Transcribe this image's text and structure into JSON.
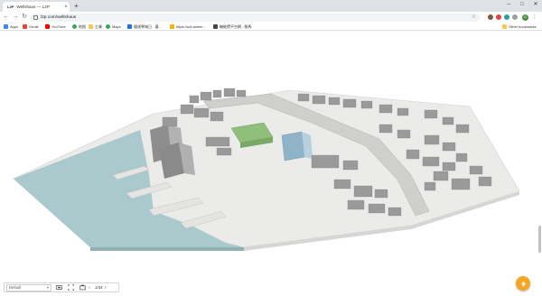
{
  "browser": {
    "tab": {
      "favicon_text": "L2P",
      "title": "Wellshaus — L2P"
    },
    "url": "l2p.com/wellshaus",
    "window_controls": {
      "minimize": "–",
      "maximize": "□",
      "close": "✕"
    },
    "avatar_letter": "G"
  },
  "bookmarks": [
    {
      "label": "Apps",
      "icon_color": "#4285f4",
      "icon": "apps-grid-icon"
    },
    {
      "label": "Gmail",
      "icon_color": "#ea4335",
      "icon": "gmail-icon"
    },
    {
      "label": "YouTube",
      "icon_color": "#ff0000",
      "icon": "youtube-icon"
    },
    {
      "label": "地图",
      "icon_color": "#34a853",
      "icon": "map-pin-icon"
    },
    {
      "label": "企業",
      "icon_color": "#f2c94c",
      "icon": "folder-icon"
    },
    {
      "label": "Maps",
      "icon_color": "#34a853",
      "icon": "map-pin-icon"
    },
    {
      "label": "優達學城日 - 優...",
      "icon_color": "#1a73e8",
      "icon": "site-icon"
    },
    {
      "label": "https://udi.admin...",
      "icon_color": "#f2b705",
      "icon": "site-icon"
    },
    {
      "label": "機能價平台網 - 帳馬",
      "icon_color": "#444444",
      "icon": "site-icon"
    }
  ],
  "other_bookmarks": "Other bookmarks",
  "viewer": {
    "view_select": "Default",
    "page_indicator": "1/34"
  },
  "colors": {
    "accent": "#f5a623",
    "water": "#a9c9cc",
    "ground": "#ececea",
    "building": "#9a9a9a",
    "highlight_green": "#8fbf7a"
  }
}
